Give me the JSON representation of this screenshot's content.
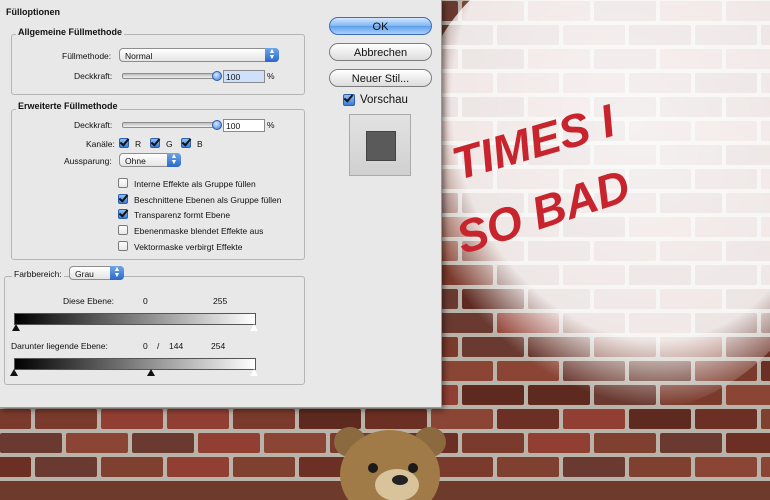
{
  "dialog": {
    "title": "Fülloptionen",
    "general": {
      "title": "Allgemeine Füllmethode",
      "fill_method_label": "Füllmethode:",
      "fill_method_value": "Normal",
      "opacity_label": "Deckkraft:",
      "opacity_value": "100",
      "percent": "%"
    },
    "advanced": {
      "title": "Erweiterte Füllmethode",
      "opacity_label": "Deckkraft:",
      "opacity_value": "100",
      "percent": "%",
      "channels_label": "Kanäle:",
      "channels": [
        {
          "label": "R",
          "checked": true
        },
        {
          "label": "G",
          "checked": true
        },
        {
          "label": "B",
          "checked": true
        }
      ],
      "knockout_label": "Aussparung:",
      "knockout_value": "Ohne",
      "options": [
        {
          "label": "Interne Effekte als Gruppe füllen",
          "checked": false
        },
        {
          "label": "Beschnittene Ebenen als Gruppe füllen",
          "checked": true
        },
        {
          "label": "Transparenz formt Ebene",
          "checked": true
        },
        {
          "label": "Ebenenmaske blendet Effekte aus",
          "checked": false
        },
        {
          "label": "Vektormaske verbirgt Effekte",
          "checked": false
        }
      ]
    },
    "blend_if": {
      "label": "Farbbereich:",
      "value": "Grau",
      "this_layer_label": "Diese Ebene:",
      "this_layer_min": "0",
      "this_layer_max": "255",
      "underlying_label": "Darunter liegende Ebene:",
      "underlying_min": "0",
      "underlying_sep": "/",
      "underlying_split": "144",
      "underlying_max": "254"
    },
    "buttons": {
      "ok": "OK",
      "cancel": "Abbrechen",
      "new_style": "Neuer Stil...",
      "preview": "Vorschau"
    }
  },
  "artwork": {
    "graffiti_line1": "TIMES I",
    "graffiti_line2": "SO BAD"
  },
  "colors": {
    "accent": "#3b7dd7",
    "brick": "#7a3a2c",
    "graffiti": "#c8242e"
  }
}
